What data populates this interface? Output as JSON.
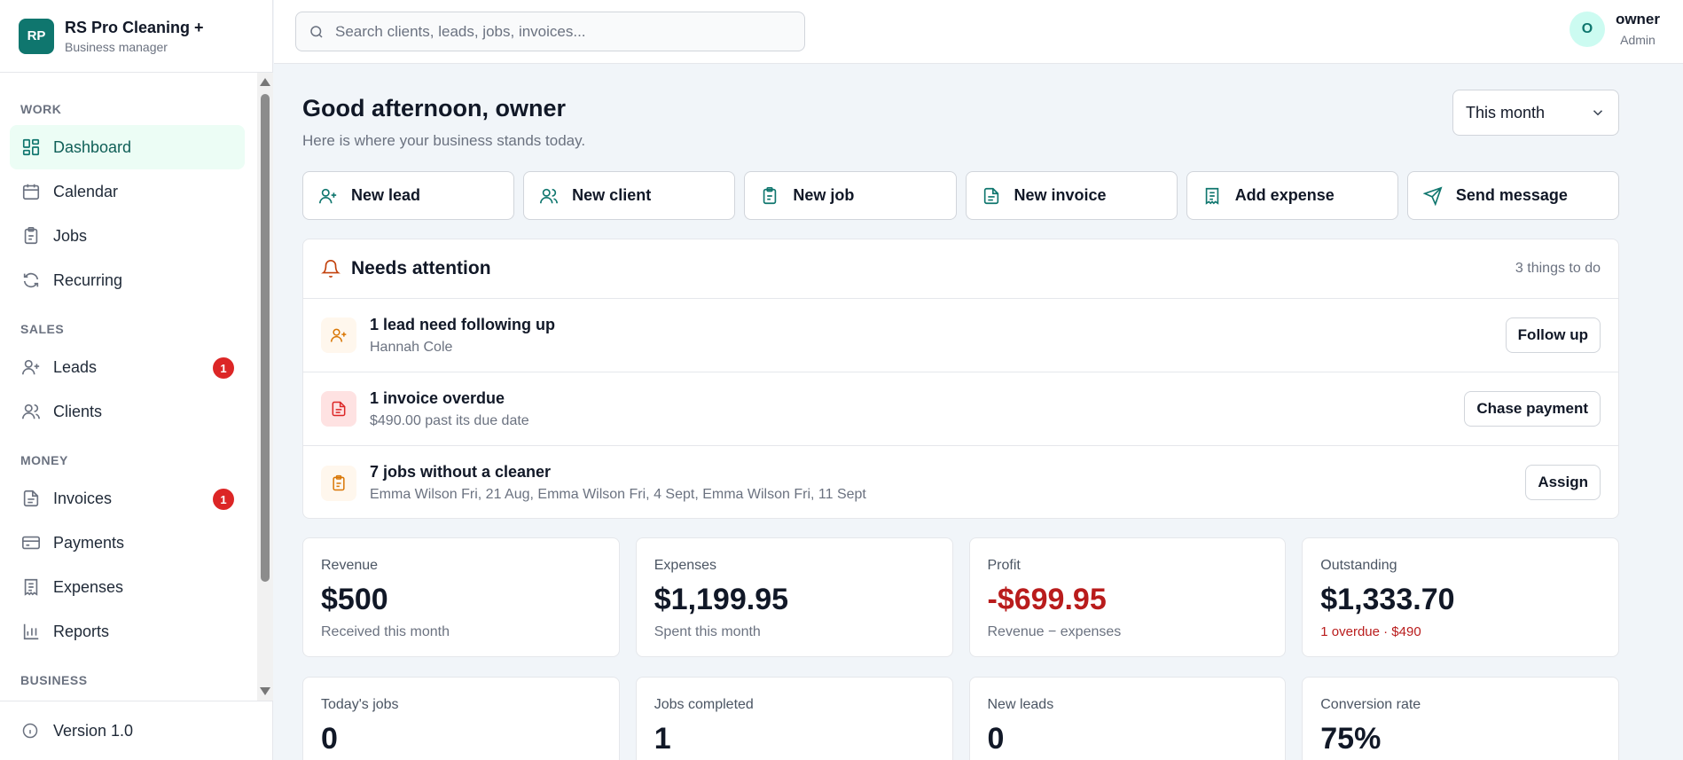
{
  "brand": {
    "logo": "RP",
    "name": "RS Pro Cleaning +",
    "subtitle": "Business manager"
  },
  "nav": {
    "sections": {
      "work": "WORK",
      "sales": "SALES",
      "money": "MONEY",
      "business": "BUSINESS"
    },
    "items": {
      "dashboard": "Dashboard",
      "calendar": "Calendar",
      "jobs": "Jobs",
      "recurring": "Recurring",
      "leads": "Leads",
      "leads_badge": "1",
      "clients": "Clients",
      "invoices": "Invoices",
      "invoices_badge": "1",
      "payments": "Payments",
      "expenses": "Expenses",
      "reports": "Reports"
    },
    "version": "Version 1.0"
  },
  "search": {
    "placeholder": "Search clients, leads, jobs, invoices..."
  },
  "user": {
    "initial": "O",
    "name": "owner",
    "role": "Admin"
  },
  "header": {
    "greeting": "Good afternoon, owner",
    "subtitle": "Here is where your business stands today.",
    "period": "This month"
  },
  "actions": [
    {
      "label": "New lead",
      "icon": "user-plus-icon"
    },
    {
      "label": "New client",
      "icon": "users-icon"
    },
    {
      "label": "New job",
      "icon": "clipboard-icon"
    },
    {
      "label": "New invoice",
      "icon": "document-icon"
    },
    {
      "label": "Add expense",
      "icon": "receipt-icon"
    },
    {
      "label": "Send message",
      "icon": "send-icon"
    }
  ],
  "attention": {
    "title": "Needs attention",
    "count": "3 things to do",
    "items": [
      {
        "title": "1 lead need following up",
        "subtitle": "Hannah Cole",
        "button": "Follow up"
      },
      {
        "title": "1 invoice overdue",
        "subtitle": "$490.00 past its due date",
        "button": "Chase payment"
      },
      {
        "title": "7 jobs without a cleaner",
        "subtitle": "Emma Wilson Fri, 21 Aug, Emma Wilson Fri, 4 Sept, Emma Wilson Fri, 11 Sept",
        "button": "Assign"
      }
    ]
  },
  "stats_row1": [
    {
      "label": "Revenue",
      "value": "$500",
      "sub": "Received this month"
    },
    {
      "label": "Expenses",
      "value": "$1,199.95",
      "sub": "Spent this month"
    },
    {
      "label": "Profit",
      "value": "-$699.95",
      "sub": "Revenue − expenses"
    },
    {
      "label": "Outstanding",
      "value": "$1,333.70",
      "sub": "1 overdue · $490"
    }
  ],
  "stats_row2": [
    {
      "label": "Today's jobs",
      "value": "0"
    },
    {
      "label": "Jobs completed",
      "value": "1"
    },
    {
      "label": "New leads",
      "value": "0"
    },
    {
      "label": "Conversion rate",
      "value": "75%"
    }
  ],
  "colors": {
    "accent": "#0f766e",
    "danger": "#dc2626",
    "warning": "#d97706"
  }
}
